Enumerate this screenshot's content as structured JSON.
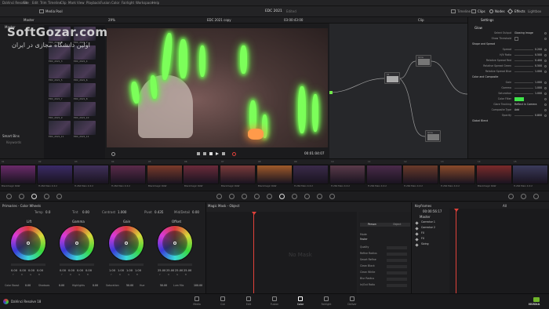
{
  "menubar": {
    "items": [
      "DaVinci Resolve",
      "File",
      "Edit",
      "Trim",
      "Timeline",
      "Clip",
      "Mark",
      "View",
      "Playback",
      "Fusion",
      "Color",
      "Fairlight",
      "Workspace",
      "Help"
    ]
  },
  "toolbar": {
    "media_pool_label": "Media Pool",
    "project_title": "EDC 2021",
    "project_status": "Edited",
    "timeline_label": "Timeline",
    "clips_label": "Clips",
    "nodes_label": "Nodes",
    "effects_label": "Effects",
    "lightbox_label": "Lightbox"
  },
  "viewer_bar": {
    "bin_label": "Master",
    "zoom": "29%",
    "timeline_name": "EDC 2021 copy",
    "timecode_start": "03:00:43:00",
    "clip_label": "Clip"
  },
  "media_pool": {
    "header": "Master",
    "smart_bins": "Smart Bins",
    "keywords": "Keywords",
    "clip_names": [
      "EDC_2021_1",
      "EDC_2021_2",
      "EDC_2021_3",
      "EDC_2021_4",
      "EDC_2021_5",
      "EDC_2021_6",
      "EDC_2021_7",
      "EDC_2021_8",
      "EDC_2021_9",
      "EDC_2021_10",
      "EDC_2021_11",
      "EDC_2021_12"
    ]
  },
  "viewer": {
    "timecode": "00:01:04:07"
  },
  "watermark": {
    "brand": "SoftGozar.com",
    "tagline": "اولین دانشگاه مجازی در ایران"
  },
  "inspector": {
    "title": "Glow",
    "tab": "Settings",
    "rows": [
      {
        "label": "Select Output",
        "value": "Glowing Image"
      },
      {
        "label": "Show Threshold",
        "value": ""
      },
      {
        "label": "Shape and Spread",
        "value": ""
      },
      {
        "label": "Spread",
        "value": "0.200"
      },
      {
        "label": "H/V Ratio",
        "value": "0.500"
      },
      {
        "label": "Relative Spread Red",
        "value": "0.400"
      },
      {
        "label": "Relative Spread Green",
        "value": "0.500"
      },
      {
        "label": "Relative Spread Blue",
        "value": "1.000"
      },
      {
        "label": "Color and Composite",
        "value": ""
      },
      {
        "label": "Gain",
        "value": "1.000"
      },
      {
        "label": "Gamma",
        "value": "1.000"
      },
      {
        "label": "Saturation",
        "value": "1.000"
      },
      {
        "label": "Color Filter",
        "value": ""
      },
      {
        "label": "Glare Tracking",
        "value": "Reflect in Camera"
      },
      {
        "label": "Composite Type",
        "value": "Add"
      },
      {
        "label": "Opacity",
        "value": "0.800"
      },
      {
        "label": "Global Blend",
        "value": ""
      }
    ]
  },
  "nodes": {
    "labels": [
      "01",
      "02",
      "Glow",
      "04",
      "Glow"
    ]
  },
  "timeline_clips": [
    {
      "label": "Blackmagic RAW",
      "color": "#6a2a6a"
    },
    {
      "label": "H.264 Main 4:2:2",
      "color": "#3a2a66"
    },
    {
      "label": "H.264 Main 4:2:2",
      "color": "#40305a"
    },
    {
      "label": "H.264 Main 4:2:2",
      "color": "#5a2a4a"
    },
    {
      "label": "Blackmagic RAW",
      "color": "#7a3a2a"
    },
    {
      "label": "Blackmagic RAW",
      "color": "#6a2a3a"
    },
    {
      "label": "Blackmagic RAW",
      "color": "#7a3a3a"
    },
    {
      "label": "Blackmagic RAW",
      "color": "#a05a2a"
    },
    {
      "label": "H.264 Main 4:2:2",
      "color": "#3a2a4a"
    },
    {
      "label": "H.264 Main 4:2:2",
      "color": "#5a3a4a"
    },
    {
      "label": "H.264 Main 4:2:2",
      "color": "#4a2a4a"
    },
    {
      "label": "H.264 Main 4:2:2",
      "color": "#6a3a2a"
    },
    {
      "label": "H.264 Main 4:2:2",
      "color": "#8a4a2a"
    },
    {
      "label": "Blackmagic RAW",
      "color": "#7a2a2a"
    },
    {
      "label": "H.264 Main 4:2:2",
      "color": "#3a3a5a"
    }
  ],
  "color_wheels": {
    "panel_title": "Primaries - Color Wheels",
    "temp_label": "Temp",
    "temp_value": "0.0",
    "tint_label": "Tint",
    "tint_value": "0.00",
    "contrast_label": "Contrast",
    "contrast_value": "1.000",
    "pivot_label": "Pivot",
    "pivot_value": "0.435",
    "middetail_label": "Mid/Detail",
    "middetail_value": "0.00",
    "wheels": [
      {
        "name": "Lift",
        "values": [
          "0.00",
          "0.00",
          "0.00",
          "0.00"
        ]
      },
      {
        "name": "Gamma",
        "values": [
          "0.00",
          "0.00",
          "0.00",
          "0.00"
        ]
      },
      {
        "name": "Gain",
        "values": [
          "1.00",
          "1.00",
          "1.00",
          "1.00"
        ]
      },
      {
        "name": "Offset",
        "values": [
          "25.00",
          "25.00",
          "25.00",
          "25.00"
        ]
      }
    ],
    "bottom": [
      {
        "label": "Color Boost",
        "value": "0.00"
      },
      {
        "label": "Shadows",
        "value": "0.00"
      },
      {
        "label": "Highlights",
        "value": "0.00"
      },
      {
        "label": "Saturation",
        "value": "50.00"
      },
      {
        "label": "Hue",
        "value": "50.00"
      },
      {
        "label": "Lum Mix",
        "value": "100.00"
      }
    ]
  },
  "magic_mask": {
    "title": "Magic Mask - Object",
    "no_mask": "No Mask",
    "tabs": [
      "Person",
      "Object"
    ],
    "mode_label": "Mode",
    "mode_value": "Faster",
    "rows": [
      "Quality",
      "Refine Radius",
      "Smart Refine",
      "Clean Black",
      "Clean White",
      "Blur Radius",
      "In/Out Ratio"
    ]
  },
  "keyframes": {
    "title": "Keyframes",
    "filter": "All",
    "timecode": "00:00:56:17",
    "master": "Master",
    "tracks": [
      "Corrector 1",
      "Corrector 2",
      "FX",
      "FX",
      "Sizing"
    ]
  },
  "pages": {
    "items": [
      "Media",
      "Cut",
      "Edit",
      "Fusion",
      "Color",
      "Fairlight",
      "Deliver"
    ],
    "active": "Color"
  },
  "footer": {
    "app_name": "DaVinci Resolve 18",
    "brand": "NVIDIA"
  },
  "colors": {
    "accent_green": "#6fe64a",
    "playhead_red": "#e0413a",
    "panel_bg": "#1e1e20"
  }
}
